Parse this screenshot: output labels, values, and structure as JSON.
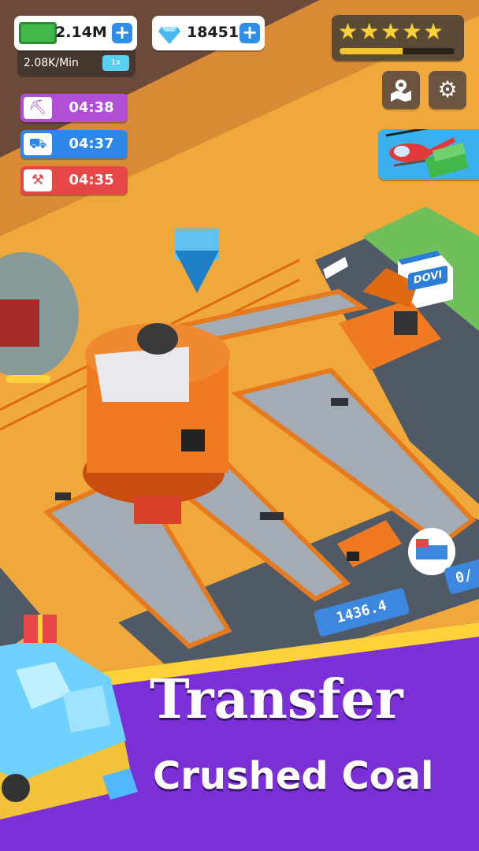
{
  "hud": {
    "cash": {
      "value": "2.14M",
      "plus": "+"
    },
    "gems": {
      "value": "18451",
      "plus": "+"
    },
    "rate": {
      "value": "2.08K/Min",
      "speed": "1x"
    },
    "rating": {
      "stars": 5,
      "progress": 0.55
    }
  },
  "timers": [
    {
      "name": "pickaxe",
      "icon": "pickaxe-icon",
      "time": "04:38",
      "color": "#b04fd6"
    },
    {
      "name": "truck",
      "icon": "dump-truck-icon",
      "time": "04:37",
      "color": "#2e86e6"
    },
    {
      "name": "bulldozer",
      "icon": "bulldozer-icon",
      "time": "04:35",
      "color": "#e64646"
    }
  ],
  "side_buttons": {
    "map_icon": "map-pin-icon",
    "settings_icon": "gear-icon"
  },
  "scene": {
    "shop_sign": "DOVI",
    "counter_plate": "1436.4",
    "counter_plate_right": "0/"
  },
  "banner": {
    "title": "Transfer",
    "subtitle": "Crushed Coal"
  },
  "colors": {
    "ground": "#f0a83a",
    "machinery": "#ef7a22",
    "conveyor": "#9fa7b0",
    "banner": "#7b2fd6"
  }
}
